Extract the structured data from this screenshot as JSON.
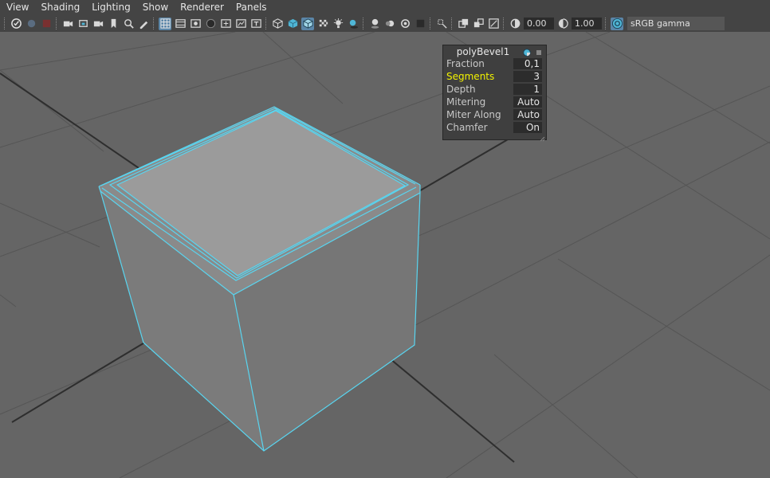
{
  "menubar": {
    "items": [
      "View",
      "Shading",
      "Lighting",
      "Show",
      "Renderer",
      "Panels"
    ]
  },
  "toolbar": {
    "exposure_value": "0.00",
    "gamma_value": "1.00",
    "color_space": "sRGB gamma",
    "icons": [
      "select-camera",
      "lock-camera",
      "camera-attributes",
      "bookmarks",
      "image-plane",
      "2d-pan-zoom",
      "grease-pencil",
      "grid",
      "film-gate",
      "resolution-gate",
      "gate-mask",
      "field-chart",
      "safe-action",
      "safe-title",
      "wireframe",
      "smooth-shade",
      "wireframe-on-shaded",
      "textured",
      "use-all-lights",
      "shadows",
      "screen-space-ao",
      "motion-blur",
      "anti-aliasing",
      "depth-of-field",
      "isolate-select",
      "xray",
      "xray-active-components",
      "xray-joints",
      "exposure",
      "gamma",
      "color-management"
    ]
  },
  "hud": {
    "title": "polyBevel1",
    "rows": [
      {
        "label": "Fraction",
        "value": "0,1",
        "highlighted": false
      },
      {
        "label": "Segments",
        "value": "3",
        "highlighted": true
      },
      {
        "label": "Depth",
        "value": "1",
        "highlighted": false
      },
      {
        "label": "Mitering",
        "value": "Auto",
        "highlighted": false
      },
      {
        "label": "Miter Along",
        "value": "Auto",
        "highlighted": false
      },
      {
        "label": "Chamfer",
        "value": "On",
        "highlighted": false
      }
    ]
  },
  "colors": {
    "viewport_bg": "#656565",
    "grid_line": "#555555",
    "grid_axis": "#2e2e2e",
    "selection_wire": "#59d5f0",
    "highlight_text": "#f2f200",
    "ui_panel": "#444444"
  }
}
